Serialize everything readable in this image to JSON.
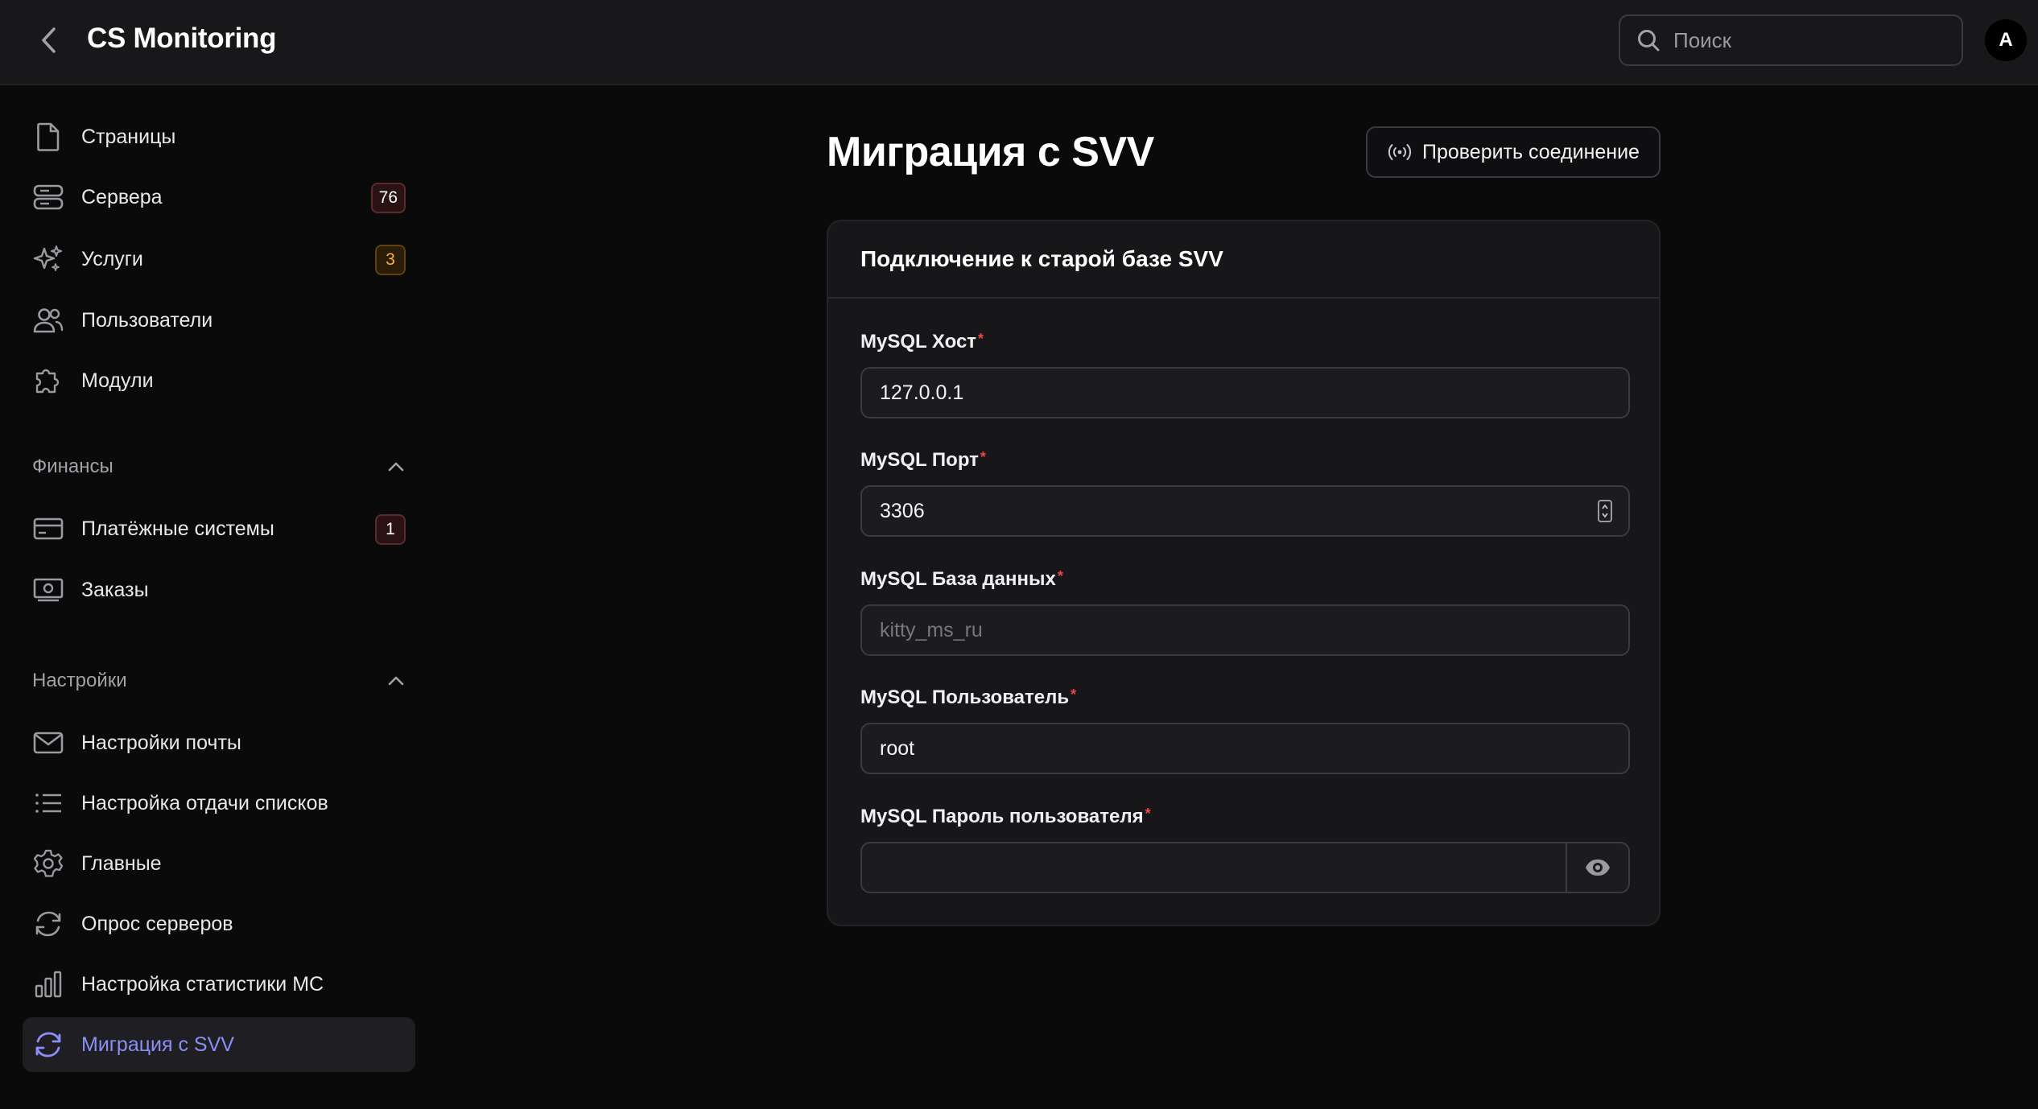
{
  "header": {
    "app_title": "CS Monitoring",
    "back_icon": "chevron-left-icon",
    "search": {
      "placeholder": "Поиск",
      "value": ""
    },
    "avatar_initial": "A"
  },
  "sidebar": {
    "items": [
      {
        "label": "Страницы",
        "icon": "file-icon"
      },
      {
        "label": "Сервера",
        "icon": "server-icon",
        "badge": "76",
        "badge_color": "danger"
      },
      {
        "label": "Услуги",
        "icon": "sparkles-icon",
        "badge": "3",
        "badge_color": "warning"
      },
      {
        "label": "Пользователи",
        "icon": "users-icon"
      },
      {
        "label": "Модули",
        "icon": "puzzle-icon"
      }
    ],
    "groups": [
      {
        "title": "Финансы",
        "expanded": true,
        "items": [
          {
            "label": "Платёжные системы",
            "icon": "credit-card-icon",
            "badge": "1",
            "badge_color": "danger"
          },
          {
            "label": "Заказы",
            "icon": "cash-icon"
          }
        ]
      },
      {
        "title": "Настройки",
        "expanded": true,
        "items": [
          {
            "label": "Настройки почты",
            "icon": "envelope-icon"
          },
          {
            "label": "Настройка отдачи списков",
            "icon": "list-icon"
          },
          {
            "label": "Главные",
            "icon": "gear-icon"
          },
          {
            "label": "Опрос серверов",
            "icon": "refresh-icon"
          },
          {
            "label": "Настройка статистики MC",
            "icon": "bar-chart-icon"
          },
          {
            "label": "Миграция с SVV",
            "icon": "sync-icon",
            "active": true
          }
        ]
      }
    ]
  },
  "main": {
    "title": "Миграция с SVV",
    "check_button": {
      "label": "Проверить соединение",
      "icon": "signal-icon"
    },
    "card": {
      "title": "Подключение к старой базе SVV",
      "fields": [
        {
          "label": "MySQL Хост",
          "required": "*",
          "value": "127.0.0.1",
          "placeholder": ""
        },
        {
          "label": "MySQL Порт",
          "required": "*",
          "value": "3306",
          "placeholder": ""
        },
        {
          "label": "MySQL База данных",
          "required": "*",
          "value": "",
          "placeholder": "kitty_ms_ru"
        },
        {
          "label": "MySQL Пользователь",
          "required": "*",
          "value": "root",
          "placeholder": ""
        },
        {
          "label": "MySQL Пароль пользователя",
          "required": "*",
          "value": "",
          "placeholder": ""
        }
      ]
    }
  },
  "colors": {
    "background": "#0a0a0b",
    "card": "#17171a",
    "accent": "#8b8ff5",
    "danger_badge": "#2a1213",
    "warning_badge_text": "#f5b73b",
    "required": "#ef4444"
  }
}
